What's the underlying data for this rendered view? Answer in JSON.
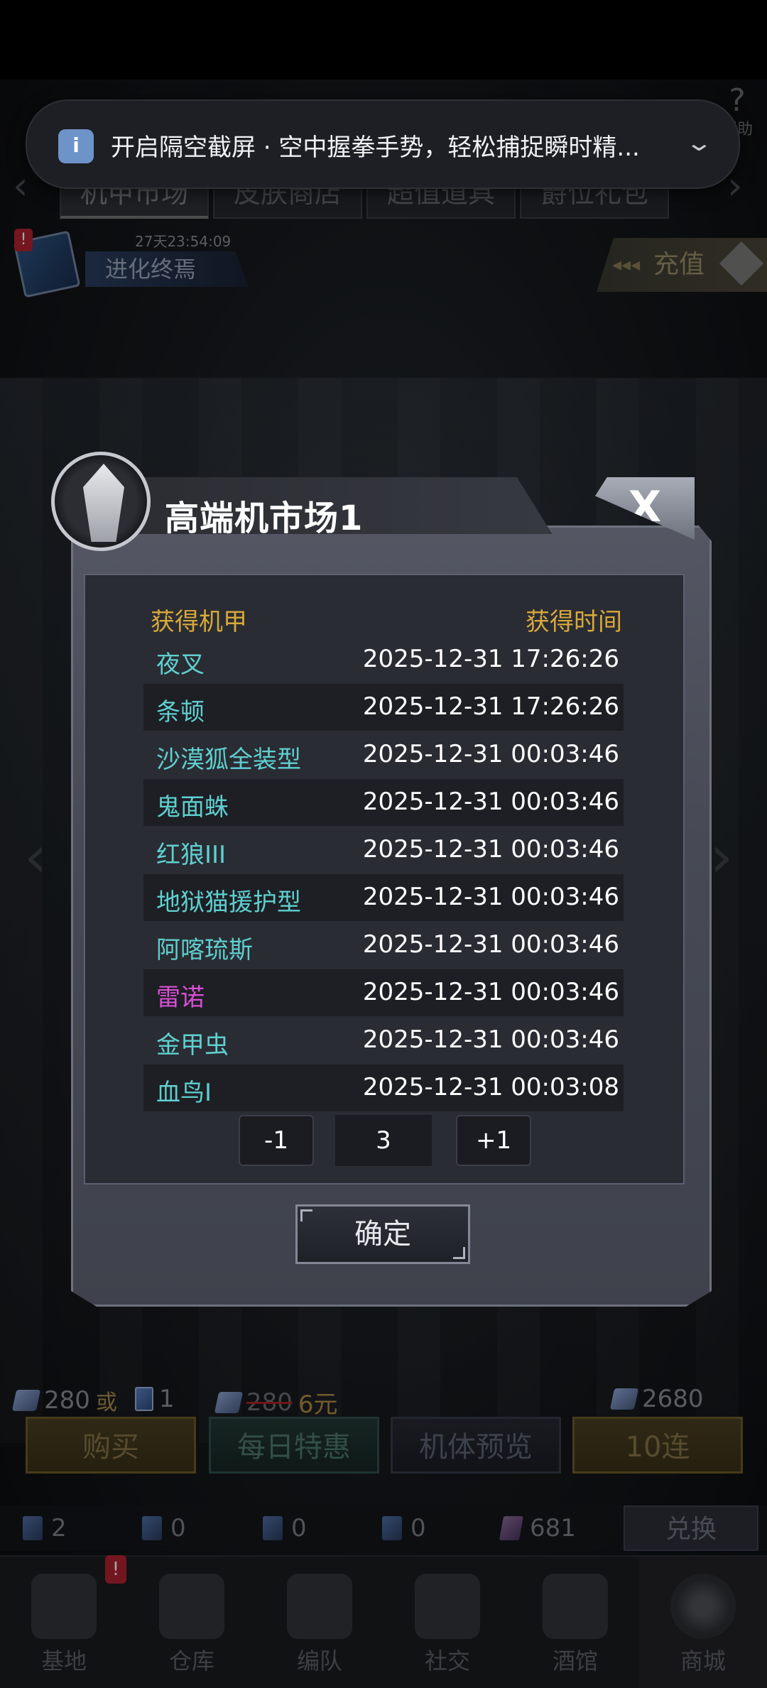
{
  "notification": {
    "text": "开启隔空截屏 · 空中握拳手势，轻松捕捉瞬时精..."
  },
  "top": {
    "help_label": "帮助"
  },
  "tabs": [
    {
      "label": "机甲市场"
    },
    {
      "label": "皮肤商店"
    },
    {
      "label": "超值道具"
    },
    {
      "label": "爵位礼包"
    }
  ],
  "evolution": {
    "timer": "27天23:54:09",
    "label": "进化终焉"
  },
  "recharge": {
    "label": "充值"
  },
  "dialog": {
    "title": "高端机市场1",
    "close_label": "X",
    "header": {
      "left": "获得机甲",
      "right": "获得时间"
    },
    "rows": [
      {
        "name": "夜叉",
        "time": "2025-12-31 17:26:26"
      },
      {
        "name": "条顿",
        "time": "2025-12-31 17:26:26"
      },
      {
        "name": "沙漠狐全装型",
        "time": "2025-12-31 00:03:46"
      },
      {
        "name": "鬼面蛛",
        "time": "2025-12-31 00:03:46"
      },
      {
        "name": "红狼III",
        "time": "2025-12-31 00:03:46"
      },
      {
        "name": "地狱猫援护型",
        "time": "2025-12-31 00:03:46"
      },
      {
        "name": "阿喀琉斯",
        "time": "2025-12-31 00:03:46"
      },
      {
        "name": "雷诺",
        "time": "2025-12-31 00:03:46"
      },
      {
        "name": "金甲虫",
        "time": "2025-12-31 00:03:46"
      },
      {
        "name": "血鸟I",
        "time": "2025-12-31 00:03:08"
      }
    ],
    "pager": {
      "prev": "-1",
      "page": "3",
      "next": "+1"
    },
    "confirm_label": "确定"
  },
  "prices": {
    "single_gem": "280",
    "or_label": "或",
    "single_card": "1",
    "old_price": "280",
    "new_price": "6元",
    "ten_price": "2680"
  },
  "actions": {
    "buy": "购买",
    "daily": "每日特惠",
    "preview": "机体预览",
    "ten": "10连"
  },
  "resources": [
    {
      "value": "2"
    },
    {
      "value": "0"
    },
    {
      "value": "0"
    },
    {
      "value": "0"
    },
    {
      "value": "681"
    }
  ],
  "exchange_label": "兑换",
  "nav": [
    {
      "label": "基地"
    },
    {
      "label": "仓库"
    },
    {
      "label": "编队"
    },
    {
      "label": "社交"
    },
    {
      "label": "酒馆"
    },
    {
      "label": "商城"
    }
  ],
  "alert_mark": "!"
}
